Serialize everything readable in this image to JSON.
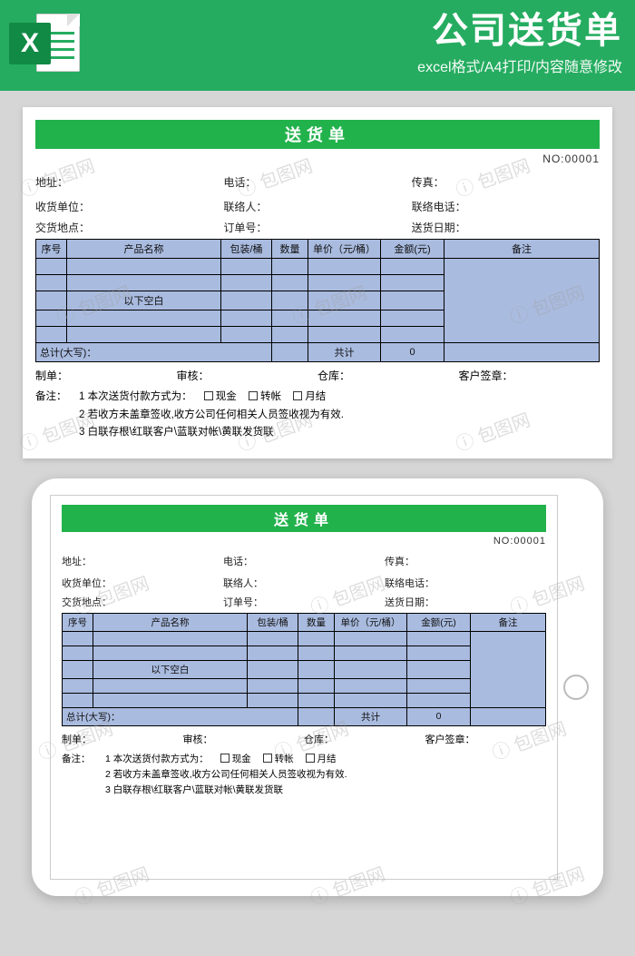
{
  "header": {
    "title": "公司送货单",
    "subtitle": "excel格式/A4打印/内容随意修改",
    "icon_letter": "X"
  },
  "doc": {
    "title": "送货单",
    "number_label": "NO:",
    "number_value": "00001",
    "row1": {
      "address": "地址：",
      "phone": "电话：",
      "fax": "传真："
    },
    "row2": {
      "recv_unit": "收货单位：",
      "contact": "联络人：",
      "contact_phone": "联络电话："
    },
    "row3": {
      "deliver_loc": "交货地点：",
      "order_no": "订单号：",
      "deliver_date": "送货日期："
    },
    "columns": {
      "seq": "序号",
      "name": "产品名称",
      "pack": "包装/桶",
      "qty": "数量",
      "price": "单价（元/桶）",
      "amount": "金额(元)",
      "note": "备注"
    },
    "blank_below": "以下空白",
    "total_cn_label": "总计(大写)：",
    "total_label": "共计",
    "total_value": "0",
    "sign": {
      "maker": "制单：",
      "audit": "审核：",
      "warehouse": "仓库：",
      "customer": "客户签章："
    },
    "notes_label": "备注：",
    "notes": {
      "n1_pre": "1 本次送货付款方式为：",
      "opt_cash": "现金",
      "opt_transfer": "转帐",
      "opt_monthly": "月结",
      "n2": "2 若收方未盖章签收,收方公司任何相关人员签收视为有效.",
      "n3": "3 白联存根\\红联客户\\蓝联对帐\\黄联发货联"
    }
  },
  "watermark_text": "包图网"
}
